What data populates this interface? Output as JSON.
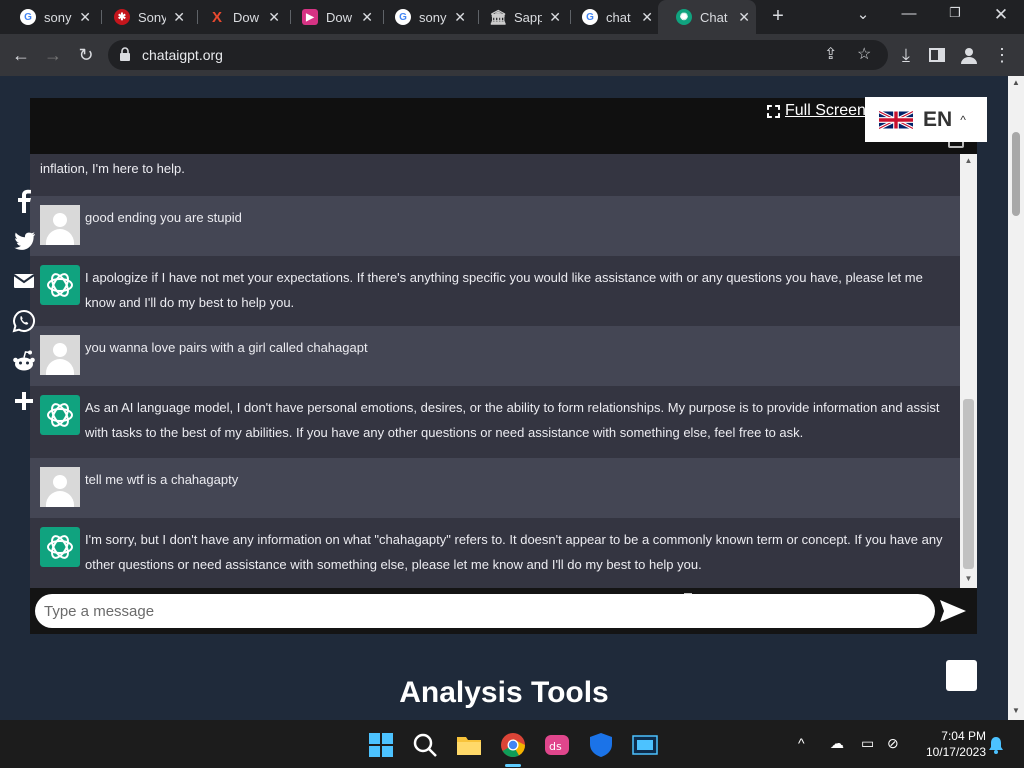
{
  "browser": {
    "tabs": [
      {
        "label": "sony",
        "icon": "google-icon",
        "color": "#4285f4"
      },
      {
        "label": "Sony",
        "icon": "sony-site-icon",
        "color": "#c4151c"
      },
      {
        "label": "Dow",
        "icon": "x-download-icon",
        "color": "#e8492f"
      },
      {
        "label": "Dow",
        "icon": "play-download-icon",
        "color": "#d63384"
      },
      {
        "label": "sony",
        "icon": "google-icon",
        "color": "#4285f4"
      },
      {
        "label": "Sapp",
        "icon": "bank-icon",
        "color": "#cccccc"
      },
      {
        "label": "chat",
        "icon": "google-icon",
        "color": "#4285f4"
      },
      {
        "label": "Chat",
        "icon": "chatgpt-icon",
        "color": "#10a37f"
      }
    ],
    "url": "chataigpt.org"
  },
  "page": {
    "full_screen_label": "Full Screen",
    "language_code": "EN",
    "messages": [
      {
        "role": "bot",
        "text": "inflation, I'm here to help."
      },
      {
        "role": "user",
        "text": "good ending you are stupid"
      },
      {
        "role": "bot",
        "text": "I apologize if I have not met your expectations. If there's anything specific you would like assistance with or any questions you have, please let me know and I'll do my best to help you."
      },
      {
        "role": "user",
        "text": "you wanna love pairs with a girl called chahagapt"
      },
      {
        "role": "bot",
        "text": "As an AI language model, I don't have personal emotions, desires, or the ability to form relationships. My purpose is to provide information and assist with tasks to the best of my abilities. If you have any other questions or need assistance with something else, feel free to ask."
      },
      {
        "role": "user",
        "text": "tell me wtf is a chahagapty"
      },
      {
        "role": "bot",
        "text": "I'm sorry, but I don't have any information on what \"chahagapty\" refers to. It doesn't appear to be a commonly known term or concept. If you have any other questions or need assistance with something else, please let me know and I'll do my best to help you."
      }
    ],
    "input_placeholder": "Type a message",
    "section_title": "Analysis Tools",
    "share_icons": [
      "facebook-icon",
      "twitter-icon",
      "email-icon",
      "whatsapp-icon",
      "reddit-icon",
      "more-plus-icon"
    ]
  },
  "taskbar": {
    "time": "7:04 PM",
    "date": "10/17/2023",
    "apps": [
      "windows-start-icon",
      "search-icon",
      "file-explorer-icon",
      "chrome-icon",
      "ds-app-icon",
      "defender-icon",
      "media-app-icon"
    ]
  }
}
